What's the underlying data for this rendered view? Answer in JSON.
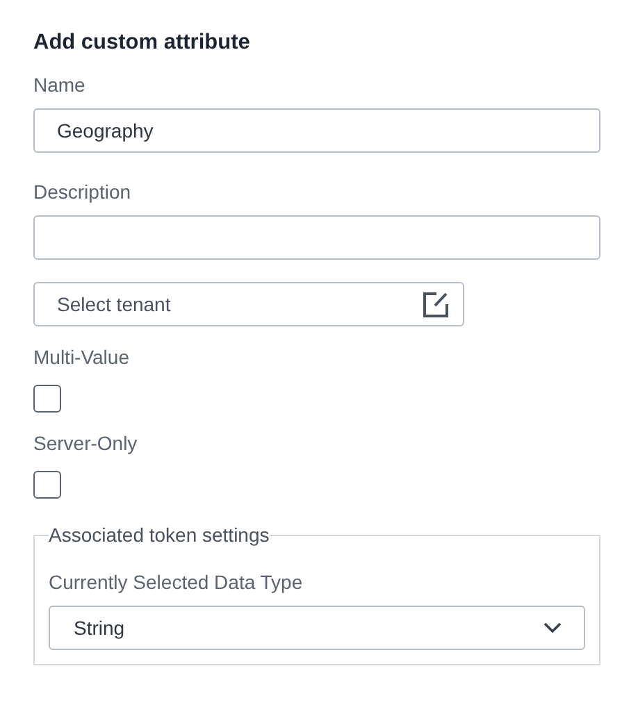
{
  "title": "Add custom attribute",
  "name_field": {
    "label": "Name",
    "value": "Geography"
  },
  "description_field": {
    "label": "Description"
  },
  "tenant_field": {
    "placeholder": "Select tenant"
  },
  "checkboxes": [
    {
      "label": "Multi-Value",
      "checked": false
    },
    {
      "label": "Server-Only",
      "checked": false
    }
  ],
  "token_settings": {
    "legend": "Associated token settings",
    "label": "Currently Selected Data Type",
    "value": "String"
  }
}
